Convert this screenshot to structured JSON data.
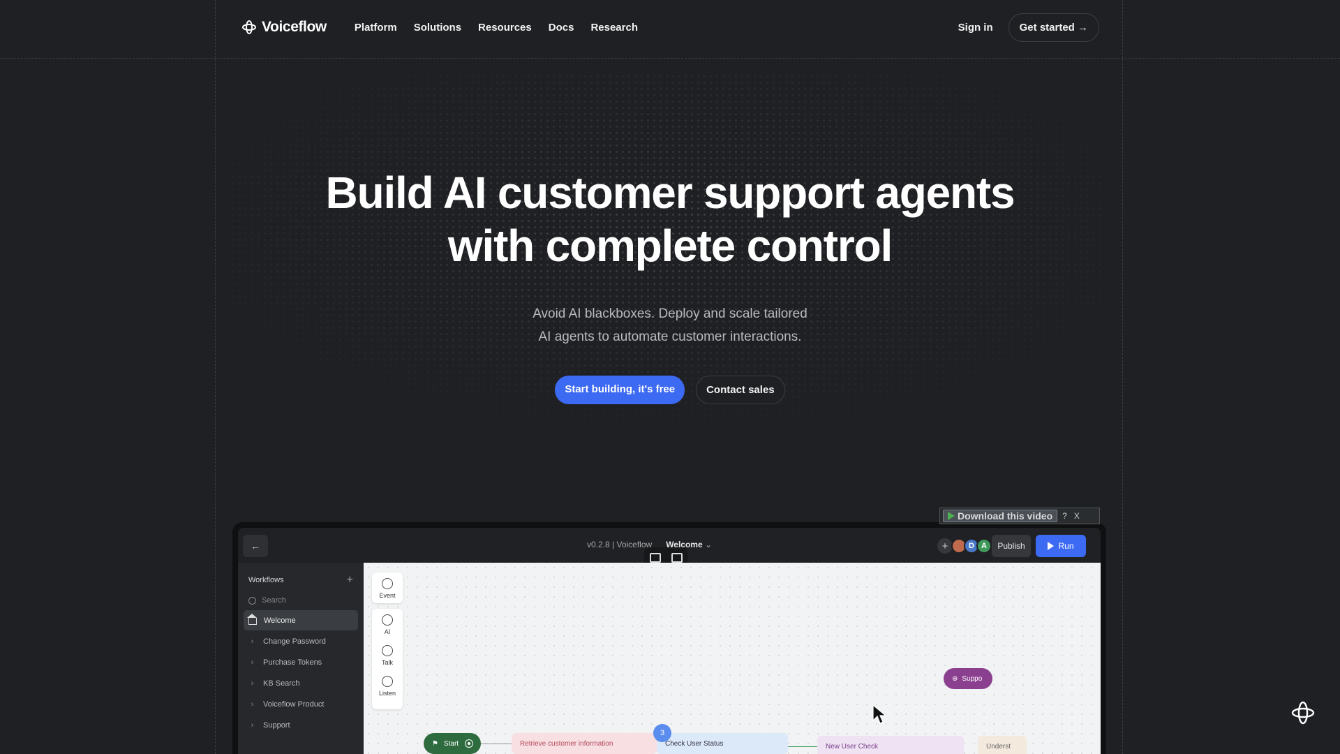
{
  "nav": {
    "brand": "Voiceflow",
    "menu": [
      "Platform",
      "Solutions",
      "Resources",
      "Docs",
      "Research"
    ],
    "sign_in": "Sign in",
    "get_started": "Get started →"
  },
  "hero": {
    "title_line1": "Build AI customer support agents",
    "title_line2": "with complete control",
    "subtitle_line1": "Avoid AI blackboxes. Deploy and scale tailored",
    "subtitle_line2": "AI agents to automate customer interactions.",
    "cta_primary": "Start building, it's free",
    "cta_secondary": "Contact sales"
  },
  "video_overlay": {
    "download_label": "Download this video",
    "help": "?",
    "close": "X"
  },
  "app": {
    "back_icon": "arrow-left-icon",
    "version_label": "v0.2.8 | Voiceflow",
    "workflow_name": "Welcome",
    "avatars": [
      "D",
      "A"
    ],
    "publish": "Publish",
    "run": "Run",
    "sidebar": {
      "heading": "Workflows",
      "search_placeholder": "Search",
      "items": [
        "Welcome",
        "Change Password",
        "Purchase Tokens",
        "KB Search",
        "Voiceflow Product",
        "Support"
      ]
    },
    "tools": {
      "event": "Event",
      "ai": "AI",
      "talk": "Talk",
      "listen": "Listen"
    },
    "nodes": {
      "start": "Start",
      "retrieve": "Retrieve customer information",
      "check": "Check User Status",
      "new_user": "New User Check",
      "underst": "Underst",
      "support": "Suppo",
      "badge": "3"
    }
  },
  "colors": {
    "background": "#1e2023",
    "accent": "#3d6af2",
    "start_node": "#2e6b3e",
    "support_pill": "#8b3f8f"
  }
}
